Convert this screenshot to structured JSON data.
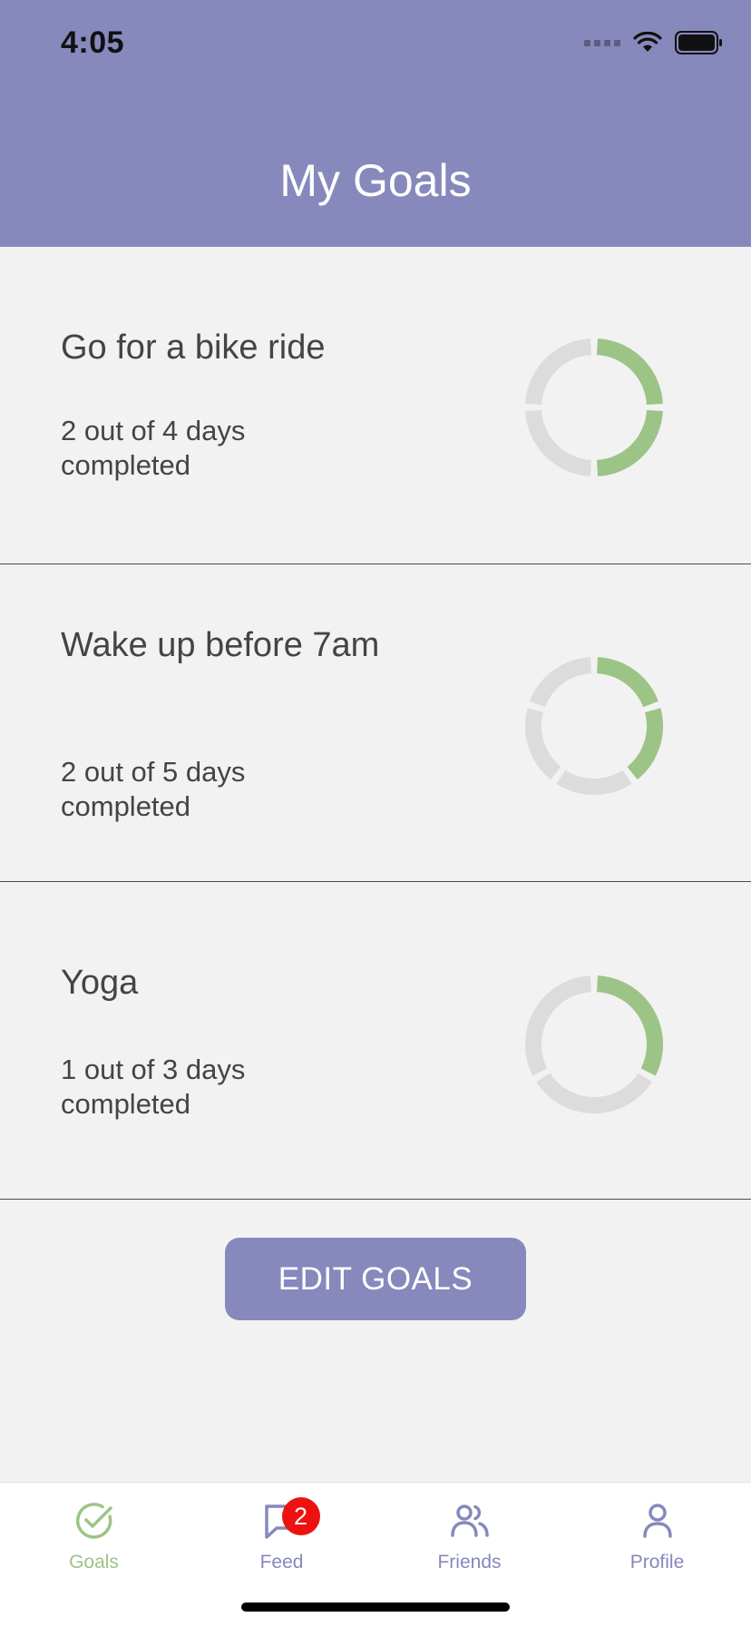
{
  "status": {
    "time": "4:05"
  },
  "header": {
    "title": "My Goals"
  },
  "goals": [
    {
      "name": "Go for a bike ride",
      "progress_text": "2 out of 4 days completed",
      "completed": 2,
      "total": 4
    },
    {
      "name": "Wake up before 7am",
      "progress_text": "2 out of 5 days completed",
      "completed": 2,
      "total": 5
    },
    {
      "name": "Yoga",
      "progress_text": "1 out of 3 days completed",
      "completed": 1,
      "total": 3
    }
  ],
  "actions": {
    "edit_label": "EDIT GOALS"
  },
  "tabs": [
    {
      "label": "Goals",
      "icon": "check-circle-icon",
      "active": true
    },
    {
      "label": "Feed",
      "icon": "chat-bubble-icon",
      "badge": "2"
    },
    {
      "label": "Friends",
      "icon": "users-icon"
    },
    {
      "label": "Profile",
      "icon": "user-icon"
    }
  ],
  "colors": {
    "brand": "#8788bc",
    "progress_done": "#9cc486",
    "progress_remaining": "#dcdcdc",
    "background": "#f2f2f2",
    "badge": "#ee1111"
  }
}
